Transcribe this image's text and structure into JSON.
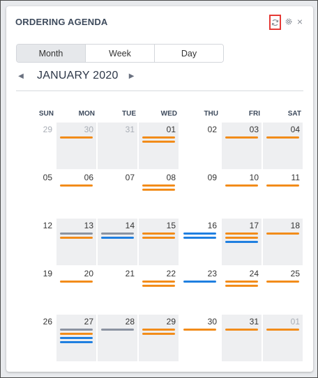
{
  "title": "ORDERING AGENDA",
  "icons": {
    "refresh": "refresh-icon",
    "settings": "gear-icon",
    "close": "close-icon"
  },
  "close_glyph": "×",
  "view_toggle": {
    "options": [
      "Month",
      "Week",
      "Day"
    ],
    "selected": "Month"
  },
  "nav": {
    "prev": "◀",
    "next": "▶",
    "month_label": "JANUARY 2020"
  },
  "weekdays": [
    "SUN",
    "MON",
    "TUE",
    "WED",
    "THU",
    "FRI",
    "SAT"
  ],
  "colors": {
    "orange": "#f28c1a",
    "gray": "#8b93a1",
    "blue": "#1f7fe0",
    "highlight": "#e53935"
  },
  "weeks": [
    [
      {
        "day": "29",
        "muted": true,
        "bars": []
      },
      {
        "day": "30",
        "muted": true,
        "bars": [
          "orange"
        ]
      },
      {
        "day": "31",
        "muted": true,
        "bars": []
      },
      {
        "day": "01",
        "bars": [
          "orange",
          "orange"
        ]
      },
      {
        "day": "02",
        "bars": []
      },
      {
        "day": "03",
        "bars": [
          "orange"
        ]
      },
      {
        "day": "04",
        "bars": [
          "orange"
        ]
      }
    ],
    [
      {
        "day": "05",
        "bars": []
      },
      {
        "day": "06",
        "bars": [
          "orange"
        ]
      },
      {
        "day": "07",
        "bars": []
      },
      {
        "day": "08",
        "bars": [
          "orange",
          "orange"
        ]
      },
      {
        "day": "09",
        "bars": []
      },
      {
        "day": "10",
        "bars": [
          "orange"
        ]
      },
      {
        "day": "11",
        "bars": [
          "orange"
        ]
      }
    ],
    [
      {
        "day": "12",
        "bars": []
      },
      {
        "day": "13",
        "bars": [
          "gray",
          "orange"
        ]
      },
      {
        "day": "14",
        "bars": [
          "gray",
          "blue"
        ]
      },
      {
        "day": "15",
        "bars": [
          "orange",
          "orange"
        ]
      },
      {
        "day": "16",
        "bars": [
          "blue",
          "blue"
        ]
      },
      {
        "day": "17",
        "bars": [
          "orange",
          "orange",
          "blue"
        ]
      },
      {
        "day": "18",
        "bars": [
          "orange"
        ]
      }
    ],
    [
      {
        "day": "19",
        "bars": []
      },
      {
        "day": "20",
        "bars": [
          "orange"
        ]
      },
      {
        "day": "21",
        "bars": []
      },
      {
        "day": "22",
        "bars": [
          "orange",
          "orange"
        ]
      },
      {
        "day": "23",
        "bars": [
          "blue"
        ]
      },
      {
        "day": "24",
        "bars": [
          "orange",
          "orange"
        ]
      },
      {
        "day": "25",
        "bars": [
          "orange"
        ]
      }
    ],
    [
      {
        "day": "26",
        "bars": []
      },
      {
        "day": "27",
        "bars": [
          "gray",
          "orange",
          "blue",
          "blue"
        ]
      },
      {
        "day": "28",
        "bars": [
          "gray"
        ]
      },
      {
        "day": "29",
        "bars": [
          "orange",
          "orange"
        ]
      },
      {
        "day": "30",
        "bars": [
          "orange"
        ]
      },
      {
        "day": "31",
        "bars": [
          "orange"
        ]
      },
      {
        "day": "01",
        "muted": true,
        "bars": [
          "orange"
        ]
      }
    ]
  ]
}
